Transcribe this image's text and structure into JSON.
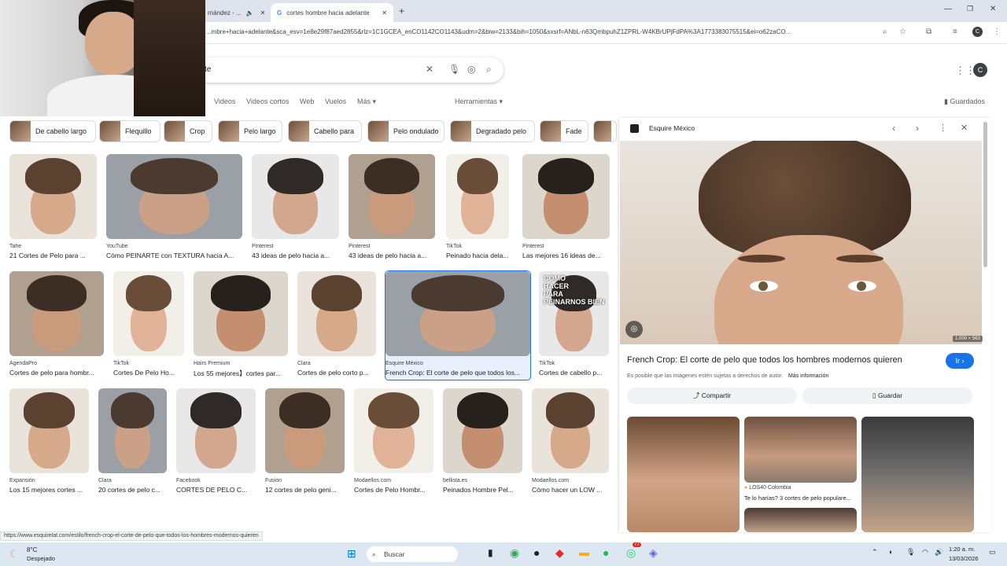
{
  "tabs": [
    {
      "label": "rnández - ...",
      "active": false
    },
    {
      "label": "cortes hombre hacia adelante",
      "active": true
    }
  ],
  "address": "...mbre+hacia+adelante&sca_esv=1e8e29f87aed2855&rlz=1C1GCEA_enCO1142CO1143&udm=2&biw=2133&bih=1050&sxsrf=ANbL-n63QmbpuhZ1ZPRL-W4KBrUPjFdPA%3A1773383075515&ei=o62zaCO...",
  "search": {
    "value": "te",
    "tabs": [
      "Videos",
      "Videos cortos",
      "Web",
      "Vuelos",
      "Más",
      "Herramientas"
    ],
    "saved": "Guardados"
  },
  "chips": [
    "De cabello largo",
    "Flequillo",
    "Crop",
    "Pelo largo",
    "Cabello para",
    "Pelo ondulado",
    "Degradado pelo",
    "Fade"
  ],
  "results_row1": [
    {
      "source": "Tahe",
      "title": "21 Cortes de Pelo para ..."
    },
    {
      "source": "YouTube",
      "title": "Cómo PEINARTE con TEXTURA hacia A..."
    },
    {
      "source": "Pinterest",
      "title": "43 ideas de pelo hacia a..."
    },
    {
      "source": "Pinterest",
      "title": "43 ideas de pelo hacia a..."
    },
    {
      "source": "TikTok",
      "title": "Peinado hacia dela..."
    },
    {
      "source": "Pinterest",
      "title": "Las mejores 16 ideas de..."
    }
  ],
  "results_row2": [
    {
      "source": "AgendaPro",
      "title": "Cortes de pelo para hombr..."
    },
    {
      "source": "TikTok",
      "title": "Cortes De Pelo Ho..."
    },
    {
      "source": "Hairs Premium",
      "title": "Los 55 mejores】cortes par..."
    },
    {
      "source": "Clara",
      "title": "Cortes de pelo corto p..."
    },
    {
      "source": "Esquire México",
      "title": "French Crop: El corte de pelo que todos los..."
    },
    {
      "source": "TikTok",
      "title": "Cortes de cabello p..."
    }
  ],
  "results_row3": [
    {
      "source": "Expansión",
      "title": "Los 15 mejores cortes ..."
    },
    {
      "source": "Clara",
      "title": "20 cortes de pelo c..."
    },
    {
      "source": "Facebook",
      "title": "CORTES DE PELO C..."
    },
    {
      "source": "Fusion",
      "title": "12 cortes de pelo geni..."
    },
    {
      "source": "Modaellos.com",
      "title": "Cortes de Pelo Hombr..."
    },
    {
      "source": "bellista.es",
      "title": "Peinados Hombre Pel..."
    },
    {
      "source": "Modaellos.com",
      "title": "Cómo hacer un LOW ..."
    }
  ],
  "thumb_overlay": {
    "line1": "COMO",
    "line2": "HACER",
    "line3": "PARA",
    "line4": "PEINARNOS BIEN"
  },
  "panel": {
    "source": "Esquire México",
    "dims": "1.000 × 563",
    "title": "French Crop: El corte de pelo que todos los hombres modernos quieren",
    "go": "Ir",
    "copyright": "Es posible que las imágenes estén sujetas a derechos de autor.",
    "more_info": "Más información",
    "share": "Compartir",
    "save": "Guardar",
    "related_source": "LOS40 Colombia",
    "related_title": "Te lo harías? 3 cortes de pelo populare..."
  },
  "status_url": "https://www.esquirelat.com/estilo/french-crop-el-corte-de-pelo-que-todos-los-hombres-modernos-quieren",
  "taskbar": {
    "temp": "8°C",
    "weather": "Despejado",
    "search": "Buscar",
    "time": "1:20 a. m.",
    "date": "13/03/2026",
    "badge": "77"
  },
  "colors": {
    "accent": "#1a73e8",
    "tabbar": "#dfe3eb",
    "taskbar": "#dde7f2"
  }
}
